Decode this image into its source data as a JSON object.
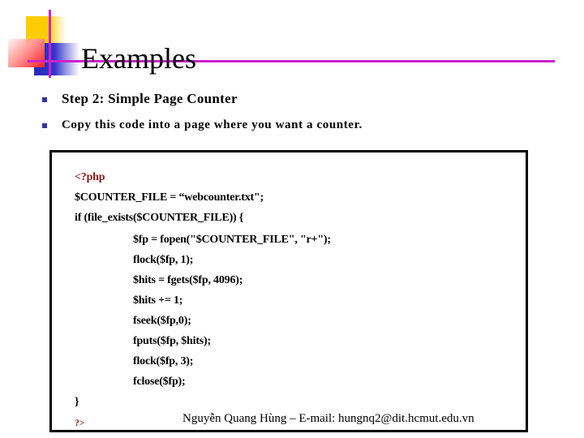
{
  "slide": {
    "title": "Examples",
    "accent_color": "#cc22cc",
    "bullet_color": "#3333aa",
    "bullets": [
      {
        "icon": "square-bullet-icon",
        "text": "Step 2: Simple Page Counter"
      },
      {
        "icon": "square-bullet-icon",
        "text": "Copy this code into a page where you want a counter."
      }
    ],
    "code": {
      "lines": [
        "<?php",
        "$COUNTER_FILE = “webcounter.txt\";",
        "if (file_exists($COUNTER_FILE)) {",
        "$fp = fopen(\"$COUNTER_FILE\", \"r+\");",
        "flock($fp, 1);",
        "$hits = fgets($fp, 4096);",
        "$hits += 1;",
        "fseek($fp,0);",
        "fputs($fp, $hits);",
        "flock($fp, 3);",
        "fclose($fp);",
        "}",
        "?>"
      ]
    },
    "footer": "Nguyễn Quang Hùng – E-mail: hungnq2@dit.hcmut.edu.vn"
  }
}
